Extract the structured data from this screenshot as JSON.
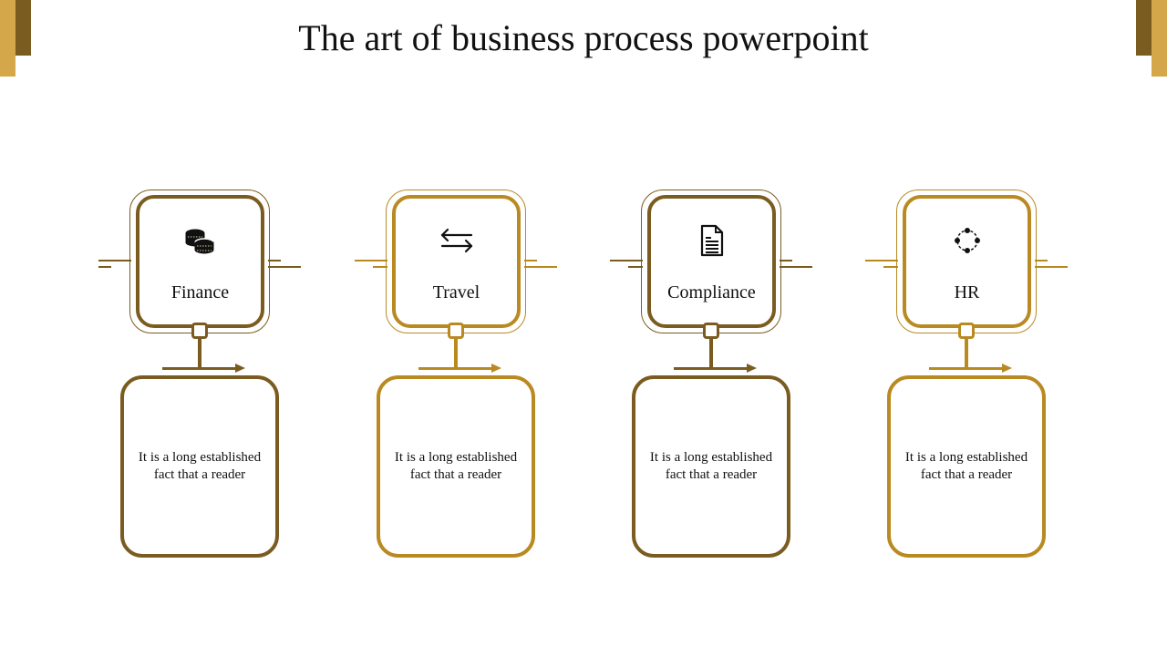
{
  "title": "The art of business process powerpoint",
  "colors": {
    "dark": "#7b5c20",
    "light": "#b98a22",
    "accent_light": "#d4a84a"
  },
  "steps": [
    {
      "label": "Finance",
      "icon": "coins-icon",
      "description": "It is a long established fact that a reader"
    },
    {
      "label": "Travel",
      "icon": "swap-arrows-icon",
      "description": "It is a long established fact that a reader"
    },
    {
      "label": "Compliance",
      "icon": "document-icon",
      "description": "It is a long established fact that a reader"
    },
    {
      "label": "HR",
      "icon": "network-circle-icon",
      "description": "It is a long established fact that a reader"
    }
  ]
}
